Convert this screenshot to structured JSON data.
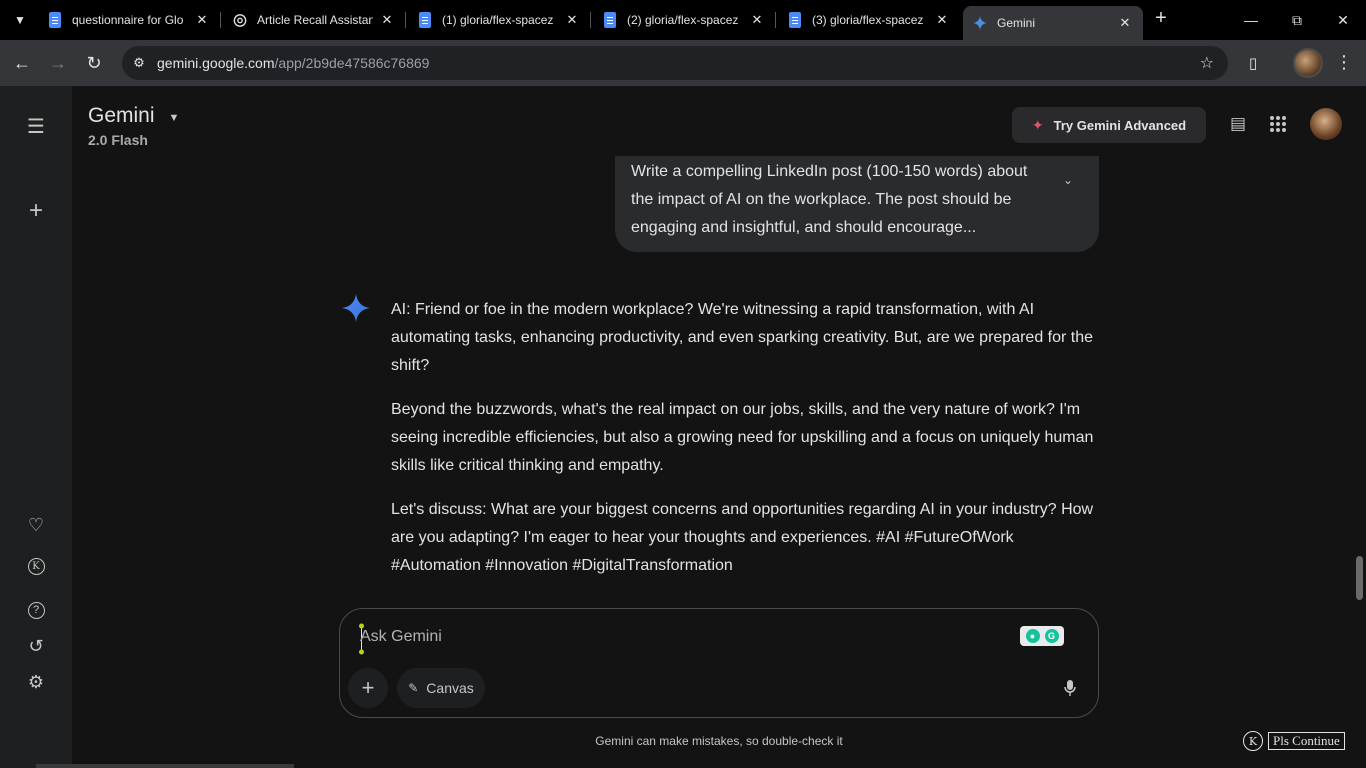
{
  "tabs": [
    {
      "title": "questionnaire for Glo",
      "favicon": "docs-icon"
    },
    {
      "title": "Article Recall Assistan",
      "favicon": "openai-icon"
    },
    {
      "title": "(1) gloria/flex-spacez",
      "favicon": "docs-icon"
    },
    {
      "title": "(2) gloria/flex-spacez",
      "favicon": "docs-icon"
    },
    {
      "title": "(3) gloria/flex-spacez",
      "favicon": "docs-icon"
    },
    {
      "title": "Gemini",
      "favicon": "gemini-icon"
    }
  ],
  "address": {
    "host": "gemini.google.com",
    "path": "/app/2b9de47586c76869"
  },
  "header": {
    "title": "Gemini",
    "model": "2.0 Flash",
    "try_advanced": "Try Gemini Advanced"
  },
  "user_prompt": "Write a compelling LinkedIn post (100-150 words) about the impact of AI on the workplace. The post should be engaging and insightful, and should encourage...",
  "response": {
    "p1": "AI: Friend or foe in the modern workplace? We're witnessing a rapid transformation, with AI automating tasks, enhancing productivity, and even sparking creativity. But, are we prepared for the shift?",
    "p2": "Beyond the buzzwords, what's the real impact on our jobs, skills, and the very nature of work? I'm seeing incredible efficiencies, but also a growing need for upskilling and a focus on uniquely human skills like critical thinking and empathy.",
    "p3": "Let's discuss: What are your biggest concerns and opportunities regarding AI in your industry? How are you adapting? I'm eager to hear your thoughts and experiences. #AI #FutureOfWork #Automation #Innovation #DigitalTransformation"
  },
  "input": {
    "placeholder": "Ask Gemini",
    "canvas_label": "Canvas"
  },
  "disclaimer": "Gemini can make mistakes, so double-check it",
  "extension": {
    "badge": "K",
    "button": "Pls Continue"
  },
  "colors": {
    "accent_spark": "#e0566a",
    "gemini_blue": "#4a90e2",
    "bg": "#131314"
  }
}
